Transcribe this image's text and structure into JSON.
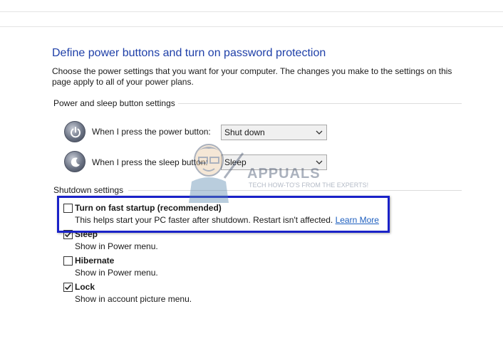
{
  "page": {
    "title": "Define power buttons and turn on password protection",
    "description": "Choose the power settings that you want for your computer. The changes you make to the settings on this page apply to all of your power plans."
  },
  "power_sleep": {
    "group_label": "Power and sleep button settings",
    "power_button": {
      "label": "When I press the power button:",
      "value": "Shut down",
      "icon": "power-icon"
    },
    "sleep_button": {
      "label": "When I press the sleep button:",
      "value": "Sleep",
      "icon": "sleep-icon"
    }
  },
  "shutdown": {
    "group_label": "Shutdown settings",
    "options": [
      {
        "title": "Turn on fast startup (recommended)",
        "desc": "This helps start your PC faster after shutdown. Restart isn't affected.",
        "link": "Learn More",
        "checked": false
      },
      {
        "title": "Sleep",
        "desc": "Show in Power menu.",
        "checked": true
      },
      {
        "title": "Hibernate",
        "desc": "Show in Power menu.",
        "checked": false
      },
      {
        "title": "Lock",
        "desc": "Show in account picture menu.",
        "checked": true
      }
    ]
  },
  "watermark": {
    "brand": "APPUALS",
    "tagline": "TECH HOW-TO'S FROM THE EXPERTS!"
  },
  "colors": {
    "title": "#1e3fa8",
    "link": "#1e5fbf",
    "highlight_border": "#1a22c8"
  }
}
